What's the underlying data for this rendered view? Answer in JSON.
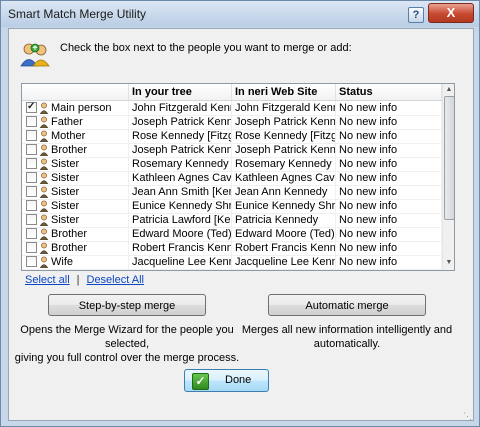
{
  "window": {
    "title": "Smart Match Merge Utility",
    "help_symbol": "?",
    "close_symbol": "X"
  },
  "instruction": "Check the box next to the people you want to merge or add:",
  "table": {
    "columns": [
      "",
      "In your tree",
      "In neri Web Site",
      "Status"
    ],
    "rows": [
      {
        "checked": true,
        "relation": "Main person",
        "tree": "John Fitzgerald Kenn...",
        "site": "John Fitzgerald Kenn...",
        "status": "No new info"
      },
      {
        "checked": false,
        "relation": "Father",
        "tree": "Joseph Patrick Kenne...",
        "site": "Joseph Patrick Kenne...",
        "status": "No new info"
      },
      {
        "checked": false,
        "relation": "Mother",
        "tree": "Rose Kennedy [Fitzge...",
        "site": "Rose Kennedy [Fitzge...",
        "status": "No new info"
      },
      {
        "checked": false,
        "relation": "Brother",
        "tree": "Joseph Patrick Kenne...",
        "site": "Joseph Patrick Kenne...",
        "status": "No new info"
      },
      {
        "checked": false,
        "relation": "Sister",
        "tree": "Rosemary Kennedy",
        "site": "Rosemary Kennedy",
        "status": "No new info"
      },
      {
        "checked": false,
        "relation": "Sister",
        "tree": "Kathleen Agnes Cave...",
        "site": "Kathleen Agnes Cave...",
        "status": "No new info"
      },
      {
        "checked": false,
        "relation": "Sister",
        "tree": "Jean Ann Smith [Kenn...",
        "site": "Jean Ann Kennedy",
        "status": "No new info"
      },
      {
        "checked": false,
        "relation": "Sister",
        "tree": "Eunice Kennedy Shriv...",
        "site": "Eunice Kennedy Shriv...",
        "status": "No new info"
      },
      {
        "checked": false,
        "relation": "Sister",
        "tree": "Patricia Lawford [Ken...",
        "site": "Patricia Kennedy",
        "status": "No new info"
      },
      {
        "checked": false,
        "relation": "Brother",
        "tree": "Edward Moore (Ted) ...",
        "site": "Edward Moore (Ted) ...",
        "status": "No new info"
      },
      {
        "checked": false,
        "relation": "Brother",
        "tree": "Robert Francis Kenne...",
        "site": "Robert Francis Kenne...",
        "status": "No new info"
      },
      {
        "checked": false,
        "relation": "Wife",
        "tree": "Jacqueline Lee Kenn...",
        "site": "Jacqueline Lee Kenn...",
        "status": "No new info"
      }
    ]
  },
  "links": {
    "select_all": "Select all",
    "separator": "|",
    "deselect_all": "Deselect All"
  },
  "buttons": {
    "step": "Step-by-step merge",
    "auto": "Automatic merge",
    "done": "Done"
  },
  "descriptions": {
    "step_line1": "Opens the Merge Wizard for the people you selected,",
    "step_line2": "giving you full control over the merge process.",
    "auto_line1": "Merges all new information intelligently and",
    "auto_line2": "automatically."
  },
  "colors": {
    "link": "#0b47c4",
    "close": "#c7482f",
    "done_check": "#2e8a1f"
  }
}
